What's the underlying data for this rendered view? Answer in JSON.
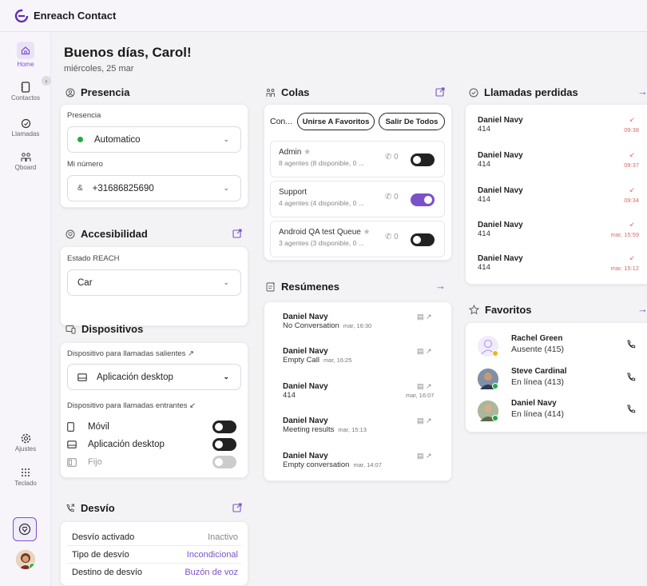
{
  "app": {
    "name": "Enreach Contact"
  },
  "sidebar": {
    "items": [
      {
        "label": "Home"
      },
      {
        "label": "Contactos"
      },
      {
        "label": "Llamadas"
      },
      {
        "label": "Qboard"
      },
      {
        "label": "Ajustes"
      },
      {
        "label": "Teclado"
      }
    ]
  },
  "greeting": {
    "title": "Buenos días, Carol!",
    "date": "miércoles, 25 mar"
  },
  "presencia": {
    "title": "Presencia",
    "presence_label": "Presencia",
    "presence_value": "Automatico",
    "number_label": "Mi número",
    "number_value": "+31686825690"
  },
  "accesibilidad": {
    "title": "Accesibilidad",
    "estado_label": "Estado REACH",
    "estado_value": "Car"
  },
  "dispositivos": {
    "title": "Dispositivos",
    "out_label": "Dispositivo para llamadas salientes ↗",
    "out_value": "Aplicación desktop",
    "in_label": "Dispositivo para llamadas entrantes ↙",
    "in_devices": [
      {
        "label": "Móvil",
        "on": false
      },
      {
        "label": "Aplicación desktop",
        "on": false
      },
      {
        "label": "Fijo",
        "on": false
      }
    ]
  },
  "desvio": {
    "title": "Desvío",
    "rows": [
      {
        "k": "Desvío activado",
        "v": "Inactivo"
      },
      {
        "k": "Tipo de desvío",
        "v": "Incondicional"
      },
      {
        "k": "Destino de desvío",
        "v": "Buzón de voz"
      }
    ]
  },
  "colas": {
    "title": "Colas",
    "tab_label": "Con...",
    "join_label": "Unirse A Favoritos",
    "leave_label": "Salir De Todos",
    "queues": [
      {
        "name": "Admin",
        "sub": "8 agentes (8 disponible, 0 ...",
        "count": "0",
        "on": false
      },
      {
        "name": "Support",
        "sub": "4 agentes (4 disponible, 0 ...",
        "count": "0",
        "on": true
      },
      {
        "name": "Android QA test Queue",
        "sub": "3 agentes (3 disponible, 0 ...",
        "count": "0",
        "on": false
      }
    ]
  },
  "resumenes": {
    "title": "Resúmenes",
    "items": [
      {
        "name": "Daniel Navy",
        "desc": "No Conversation",
        "time": "mar, 16:30"
      },
      {
        "name": "Daniel Navy",
        "desc": "Empty Call",
        "time": "mar, 16:25"
      },
      {
        "name": "Daniel Navy",
        "desc": "414",
        "time": "mar, 16:07"
      },
      {
        "name": "Daniel Navy",
        "desc": "Meeting results",
        "time": "mar, 15:13"
      },
      {
        "name": "Daniel Navy",
        "desc": "Empty conversation",
        "time": "mar, 14:07"
      }
    ]
  },
  "perdidas": {
    "title": "Llamadas perdidas",
    "items": [
      {
        "name": "Daniel Navy",
        "num": "414",
        "time": "09:38"
      },
      {
        "name": "Daniel Navy",
        "num": "414",
        "time": "09:37"
      },
      {
        "name": "Daniel Navy",
        "num": "414",
        "time": "09:34"
      },
      {
        "name": "Daniel Navy",
        "num": "414",
        "time": "mar, 15:59"
      },
      {
        "name": "Daniel Navy",
        "num": "414",
        "time": "mar, 15:12"
      }
    ]
  },
  "favoritos": {
    "title": "Favoritos",
    "items": [
      {
        "name": "Rachel Green",
        "status": "Ausente (415)"
      },
      {
        "name": "Steve Cardinal",
        "status": "En línea (413)"
      },
      {
        "name": "Daniel Navy",
        "status": "En línea (414)"
      }
    ]
  },
  "colors": {
    "accent": "#7b51c9",
    "online": "#27a844",
    "away": "#f2b31b",
    "missed": "#d96a6a"
  }
}
